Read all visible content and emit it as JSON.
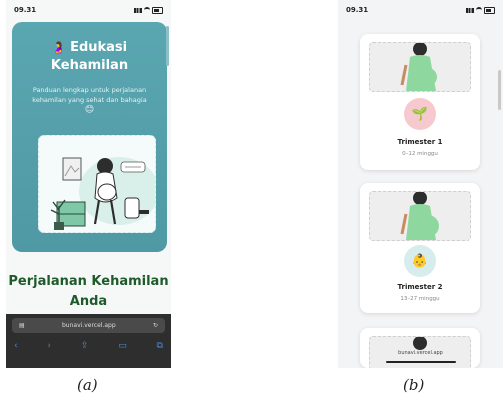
{
  "phone_a": {
    "status_time": "09.31",
    "hero": {
      "title_emoji": "🤰",
      "title_line1": "Edukasi",
      "title_line2": "Kehamilan",
      "subtitle": "Panduan lengkap untuk perjalanan kehamilan yang sehat dan bahagia",
      "subtitle_emoji": "😊"
    },
    "section_title_line1": "Perjalanan Kehamilan",
    "section_title_line2": "Anda",
    "browser": {
      "url": "bunavi.vercel.app"
    }
  },
  "phone_b": {
    "status_time": "09.31",
    "cards": [
      {
        "title": "Trimester 1",
        "subtitle": "0–12 minggu",
        "badge_icon": "sprout-icon",
        "badge_color": "#f6c9cf"
      },
      {
        "title": "Trimester 2",
        "subtitle": "13–27 minggu",
        "badge_icon": "baby-icon",
        "badge_color": "#d7ecec"
      }
    ],
    "bottom_url": "bunavi.vercel.app"
  },
  "captions": {
    "a": "(a)",
    "b": "(b)"
  },
  "colors": {
    "hero_teal": "#5aa6b1",
    "section_title_green": "#1f5a2a",
    "browser_dark": "#2e2e2e"
  }
}
